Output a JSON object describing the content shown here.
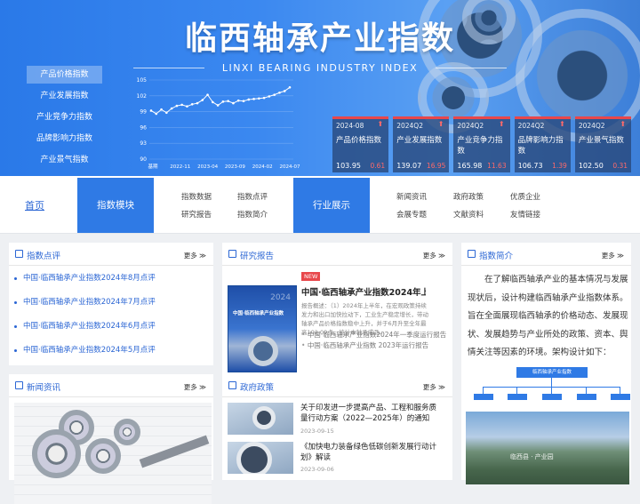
{
  "hero": {
    "title": "临西轴承产业指数",
    "subtitle": "LINXI BEARING INDUSTRY INDEX",
    "menu": [
      "产品价格指数",
      "产业发展指数",
      "产业竞争力指数",
      "品牌影响力指数",
      "产业景气指数"
    ],
    "menu_active_index": 0
  },
  "chart_data": {
    "type": "line",
    "title": "",
    "xlabel": "",
    "ylabel": "",
    "x_tick_labels": [
      "基期",
      "2022-11",
      "2023-04",
      "2023-09",
      "2024-02",
      "2024-07"
    ],
    "y_ticks": [
      90,
      93,
      96,
      99,
      102,
      105
    ],
    "ylim": [
      90,
      105
    ],
    "grid": true,
    "series": [
      {
        "values": [
          99.2,
          98.6,
          99.4,
          98.8,
          99.6,
          100.1,
          100.3,
          100.0,
          100.4,
          100.6,
          101.2,
          102.2,
          100.8,
          100.2,
          100.9,
          101.0,
          100.6,
          101.1,
          101.0,
          101.3,
          101.4,
          101.5,
          101.6,
          101.9,
          102.2,
          102.6,
          102.9,
          103.6
        ]
      }
    ],
    "color": "#ffffff"
  },
  "cards": [
    {
      "period": "2024-08",
      "name": "产品价格指数",
      "value": "103.95",
      "change": "0.61"
    },
    {
      "period": "2024Q2",
      "name": "产业发展指数",
      "value": "139.07",
      "change": "16.95"
    },
    {
      "period": "2024Q2",
      "name": "产业竞争力指数",
      "value": "165.98",
      "change": "11.63"
    },
    {
      "period": "2024Q2",
      "name": "品牌影响力指数",
      "value": "106.73",
      "change": "1.39"
    },
    {
      "period": "2024Q2",
      "name": "产业景气指数",
      "value": "102.50",
      "change": "0.31"
    }
  ],
  "nav": {
    "home": "首页",
    "block1": "指数模块",
    "block1_links": [
      "指数数据",
      "指数点评",
      "研究报告",
      "指数简介"
    ],
    "block2": "行业展示",
    "block2_links": [
      "新闻资讯",
      "政府政策",
      "优质企业",
      "会展专题",
      "文献资料",
      "友情链接"
    ]
  },
  "more_label": "更多",
  "comments": {
    "title": "指数点评",
    "items": [
      "中国·临西轴承产业指数2024年8月点评",
      "中国·临西轴承产业指数2024年7月点评",
      "中国·临西轴承产业指数2024年6月点评",
      "中国·临西轴承产业指数2024年5月点评"
    ]
  },
  "reports": {
    "title": "研究报告",
    "new_tag": "NEW",
    "book_title": "中国·临西轴承产业指数",
    "book_year": "2024",
    "headline": "中国·临西轴承产业指数2024年上半年...",
    "desc": "报告概述：（1）2024年上半年，在宏观政策持续发力和出口加快拉动下，工业生产稳定增长，带动轴承产品价格指数稳中上升，并于6月升至全年最高102.09点，统计中轴承成品...",
    "links": [
      "中国·临西轴承产业指数2024年一季度运行报告",
      "中国·临西轴承产业指数 2023年运行报告"
    ]
  },
  "intro": {
    "title": "指数简介",
    "text": "在了解临西轴承产业的基本情况与发展现状后，设计构建临西轴承产业指数体系。旨在全面展现临西轴承的价格动态、发展现状、发展趋势与产业所处的政策、资本、舆情关注等因素的环境。架构设计如下：",
    "org_root": "临西轴承产业指数",
    "photo_label": "临西县 · 产业园"
  },
  "news": {
    "title": "新闻资讯"
  },
  "policy": {
    "title": "政府政策",
    "items": [
      {
        "title": "关于印发进一步提高产品、工程和服务质量行动方案（2022—2025年）的通知",
        "date": "2023-09-15"
      },
      {
        "title": "《加快电力装备绿色低碳创新发展行动计划》解读",
        "date": "2023-09-06"
      }
    ]
  }
}
